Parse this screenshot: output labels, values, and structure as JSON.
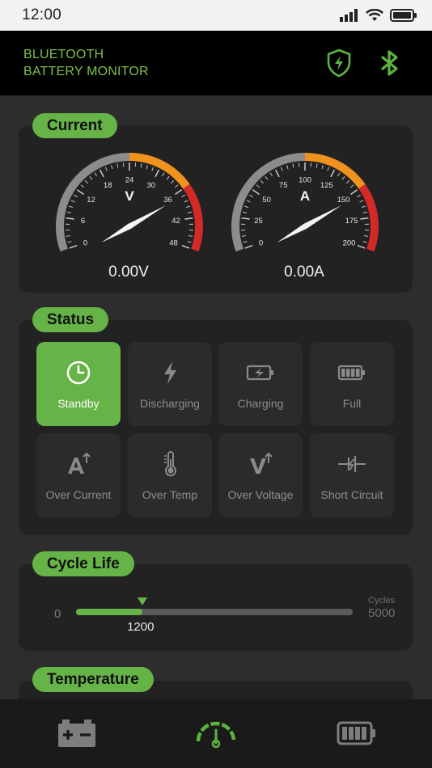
{
  "status_bar": {
    "time": "12:00"
  },
  "header": {
    "title_line1": "BLUETOOTH",
    "title_line2": "BATTERY MONITOR",
    "icons": [
      "shield-bolt-icon",
      "bluetooth-icon"
    ]
  },
  "current": {
    "label": "Current",
    "voltage_gauge": {
      "unit": "V",
      "ticks": [
        "0",
        "6",
        "12",
        "18",
        "24",
        "30",
        "36",
        "42",
        "48"
      ],
      "value": 0,
      "reading": "0.00V"
    },
    "ampere_gauge": {
      "unit": "A",
      "ticks": [
        "0",
        "25",
        "50",
        "75",
        "100",
        "125",
        "150",
        "175",
        "200"
      ],
      "value": 0,
      "reading": "0.00A"
    },
    "colors": {
      "normal": "#8c8c8c",
      "warning": "#f0921e",
      "danger": "#d42a27"
    }
  },
  "status": {
    "label": "Status",
    "tiles": [
      {
        "label": "Standby",
        "icon": "clock-icon",
        "active": true
      },
      {
        "label": "Discharging",
        "icon": "bolt-icon",
        "active": false
      },
      {
        "label": "Charging",
        "icon": "battery-charging-icon",
        "active": false
      },
      {
        "label": "Full",
        "icon": "battery-full-icon",
        "active": false
      },
      {
        "label": "Over Current",
        "icon": "ampere-up-icon",
        "active": false
      },
      {
        "label": "Over Temp",
        "icon": "thermometer-icon",
        "active": false
      },
      {
        "label": "Over Voltage",
        "icon": "voltage-up-icon",
        "active": false
      },
      {
        "label": "Short Circuit",
        "icon": "short-circuit-icon",
        "active": false
      }
    ],
    "accent": "#66b347"
  },
  "cycle_life": {
    "label": "Cycle Life",
    "min": "0",
    "max_label": "Cycles",
    "max": "5000",
    "value": "1200",
    "fraction": 0.24
  },
  "temperature": {
    "label": "Temperature"
  },
  "bottom_nav": [
    {
      "icon": "battery-terminal-icon",
      "active": false
    },
    {
      "icon": "gauge-icon",
      "active": true
    },
    {
      "icon": "battery-level-icon",
      "active": false
    }
  ]
}
